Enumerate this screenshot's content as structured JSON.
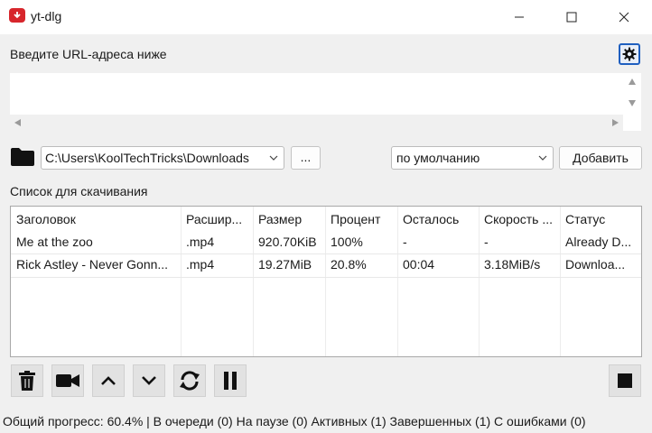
{
  "window": {
    "title": "yt-dlg"
  },
  "url_section": {
    "label": "Введите URL-адреса ниже",
    "value": ""
  },
  "path": {
    "value": "C:\\Users\\KoolTechTricks\\Downloads",
    "browse_label": "..."
  },
  "format": {
    "selected": "по умолчанию"
  },
  "add_label": "Добавить",
  "download_list": {
    "label": "Список для скачивания",
    "columns": [
      "Заголовок",
      "Расшир...",
      "Размер",
      "Процент",
      "Осталось",
      "Скорость ...",
      "Статус"
    ],
    "rows": [
      [
        "Me at the zoo",
        ".mp4",
        "920.70KiB",
        "100%",
        "-",
        "-",
        "Already D..."
      ],
      [
        "Rick Astley - Never Gonn...",
        ".mp4",
        "19.27MiB",
        "20.8%",
        "00:04",
        "3.18MiB/s",
        "Downloa..."
      ]
    ]
  },
  "toolbar": {
    "icons": [
      "trash-icon",
      "video-camera-icon",
      "arrow-up-icon",
      "arrow-down-icon",
      "reload-icon",
      "pause-icon",
      "stop-icon"
    ]
  },
  "status_bar": {
    "text": "Общий прогресс: 60.4% | В очереди (0) На паузе (0) Активных (1) Завершенных (1) С ошибками (0)"
  },
  "colors": {
    "app_icon": "#d7262c",
    "settings_focus": "#1f5fbf",
    "window_bg": "#f0f0f0"
  }
}
